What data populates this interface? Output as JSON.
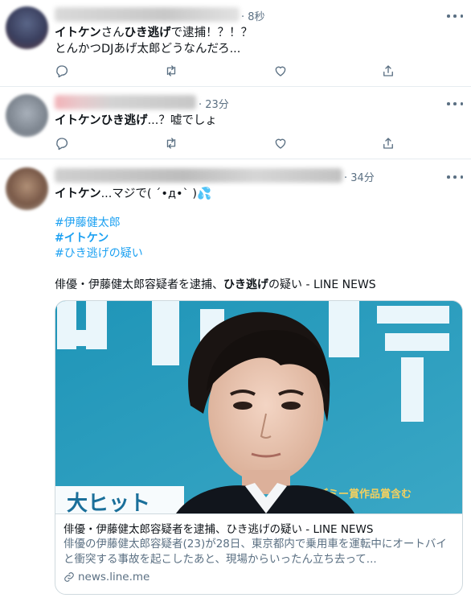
{
  "tweets": [
    {
      "time": "· 8秒",
      "line1": {
        "bold1": "イトケン",
        "text1": "さん",
        "bold2": "ひき逃げ",
        "text2": "で逮捕！？！？"
      },
      "line2": "とんかつDJあげ太郎どうなんだろ..."
    },
    {
      "time": "· 23分",
      "line1": {
        "bold1": "イトケンひき逃げ",
        "text1": "...？嘘でしょ"
      }
    },
    {
      "time": "· 34分",
      "line1": {
        "bold1": "イトケン",
        "text1": "...マジで( ´•д•` )💦"
      },
      "hashtags": [
        "#伊藤健太郎",
        "#イトケン",
        "#ひき逃げの疑い"
      ],
      "link_text": {
        "text1": "俳優・伊藤健太郎容疑者を逮捕、",
        "bold1": "ひき逃げ",
        "text2": "の疑い  - LINE NEWS"
      },
      "card": {
        "image_sign_text": "アカデミー賞作品賞含む",
        "image_banner_text": "大ヒット",
        "title": "俳優・伊藤健太郎容疑者を逮捕、ひき逃げの疑い - LINE NEWS",
        "description": "俳優の伊藤健太郎容疑者(23)が28日、東京都内で乗用車を運転中にオートバイと衝突する事故を起こしたあと、現場からいったん立ち去って...",
        "domain": "news.line.me"
      }
    }
  ],
  "icons": [
    "reply-icon",
    "retweet-icon",
    "like-icon",
    "share-icon",
    "more-icon",
    "link-icon"
  ],
  "colors": {
    "link": "#1da1f2",
    "muted": "#5b7083",
    "border": "#e6ecf0"
  }
}
